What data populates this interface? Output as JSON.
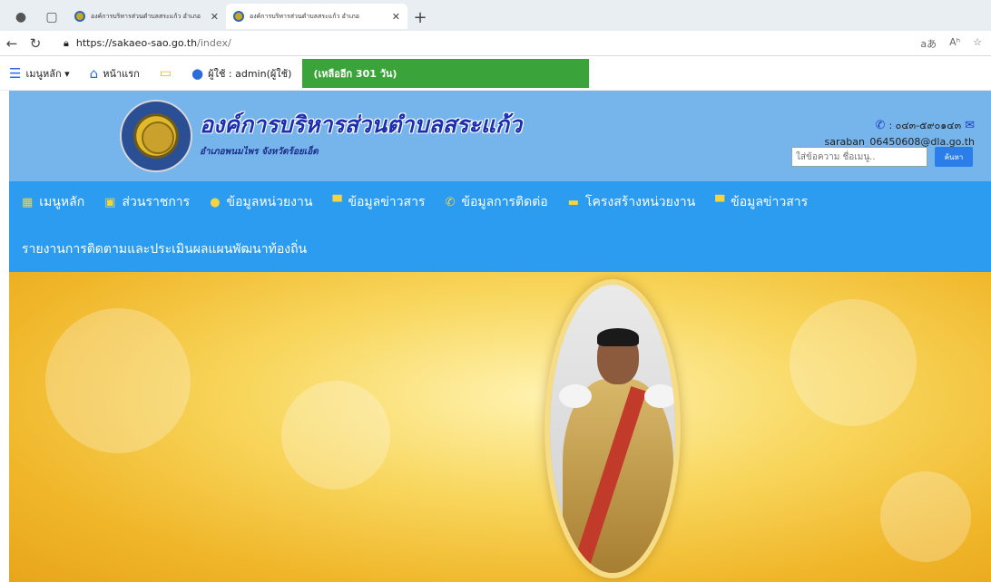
{
  "browser": {
    "tabs": [
      {
        "title": "องค์การบริหารส่วนตำบลสระแก้ว อำเภอ",
        "active": false
      },
      {
        "title": "องค์การบริหารส่วนตำบลสระแก้ว อำเภอ",
        "active": true
      }
    ],
    "url_domain": "https://sakaeo-sao.go.th",
    "url_path": "/index/",
    "addr_right": [
      "aあ",
      "Aʰ",
      "☆"
    ]
  },
  "adminbar": {
    "menu_label": "เมนูหลัก ▾",
    "home_label": "หน้าแรก",
    "user_label": "ผู้ใช้ : admin(ผู้ใช้)",
    "days_left": "(เหลืออีก 301 วัน)"
  },
  "header": {
    "org_name": "องค์การบริหารส่วนตำบลสระแก้ว",
    "org_sub": "อำเภอพนมไพร จังหวัดร้อยเอ็ด",
    "phone": ": ๐๔๓-๕๙๐๑๔๓",
    "email": "saraban_06450608@dla.go.th",
    "search_placeholder": "ใส่ข้อความ ชื่อเมนู..",
    "search_button": "ค้นหา"
  },
  "mainnav": {
    "row1": [
      {
        "label": "เมนูหลัก",
        "icon": "grid-icon",
        "glyph": "▦"
      },
      {
        "label": "ส่วนราชการ",
        "icon": "calendar-icon",
        "glyph": "▣"
      },
      {
        "label": "ข้อมูลหน่วยงาน",
        "icon": "info-icon",
        "glyph": "●"
      },
      {
        "label": "ข้อมูลข่าวสาร",
        "icon": "chat-icon",
        "glyph": "▀"
      },
      {
        "label": "ข้อมูลการติดต่อ",
        "icon": "phone-icon",
        "glyph": "✆"
      },
      {
        "label": "โครงสร้างหน่วยงาน",
        "icon": "folder-icon",
        "glyph": "▬"
      },
      {
        "label": "ข้อมูลข่าวสาร",
        "icon": "chat-icon",
        "glyph": "▀"
      }
    ],
    "row2": [
      {
        "label": "รายงานการติดตามและประเมินผลแผนพัฒนาท้องถิ่น"
      }
    ]
  },
  "colors": {
    "header_bg": "#76b4ec",
    "nav_bg": "#2b9cf0",
    "badge_bg": "#3aa43a",
    "banner_gold": "#f0b629"
  }
}
